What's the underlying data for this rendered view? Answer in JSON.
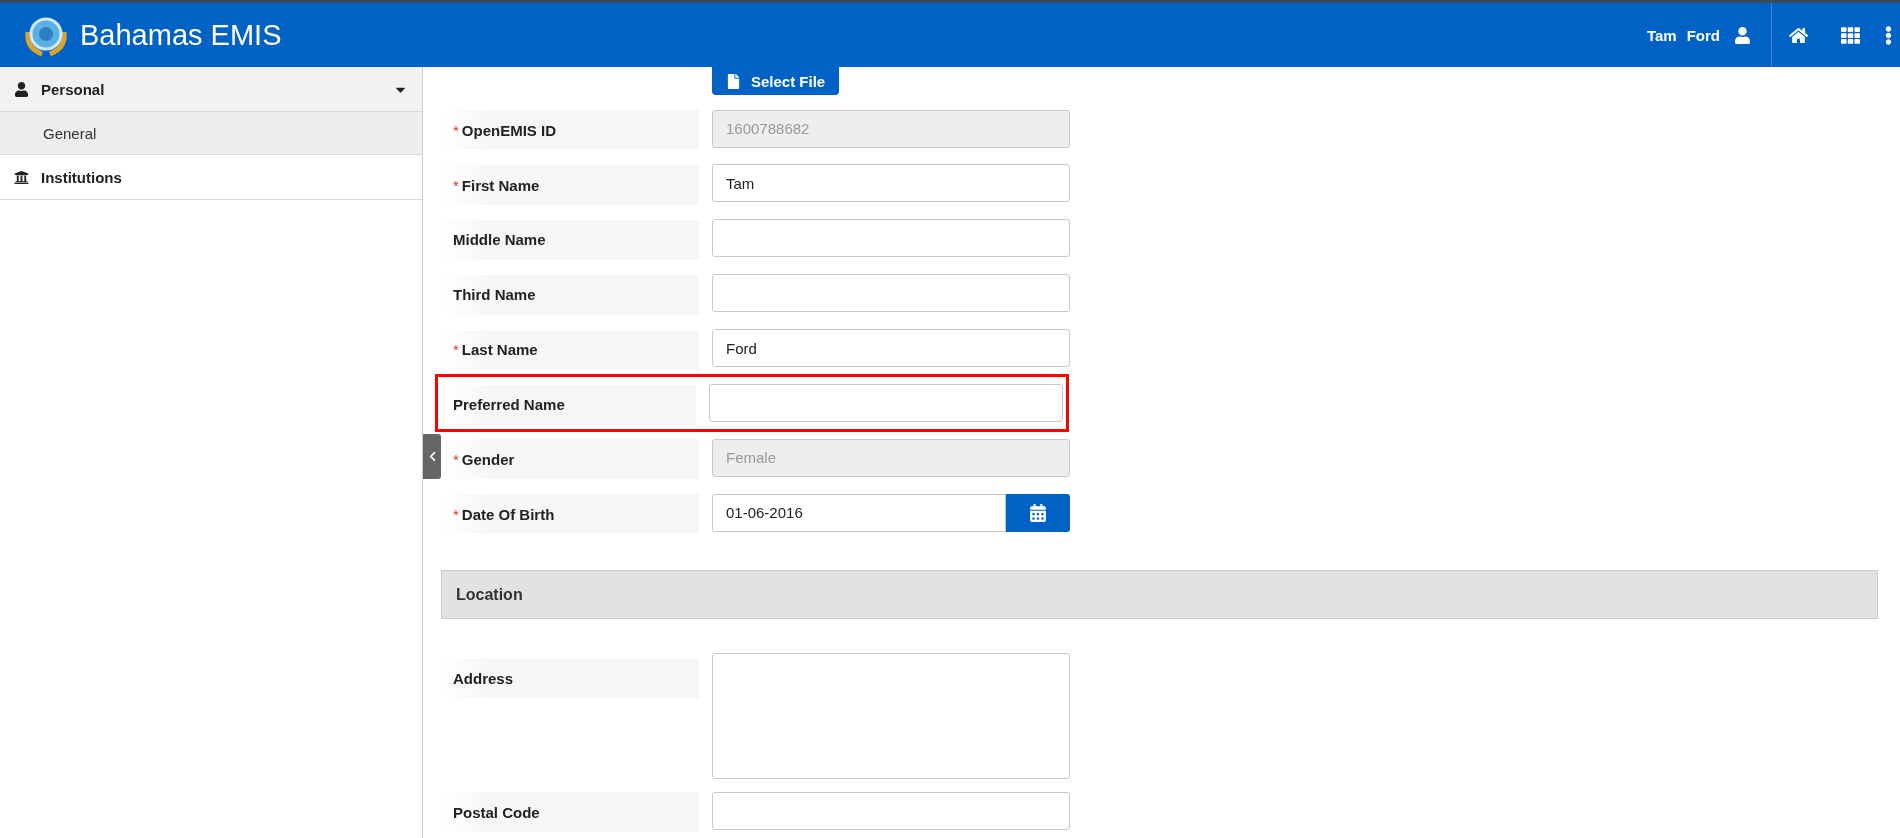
{
  "header": {
    "title": "Bahamas EMIS",
    "user": [
      "Tam",
      "Ford"
    ]
  },
  "sidebar": {
    "items": [
      {
        "label": "Personal",
        "expanded": true,
        "children": [
          {
            "label": "General",
            "selected": true
          }
        ]
      },
      {
        "label": "Institutions",
        "expanded": false
      }
    ]
  },
  "form": {
    "select_file": "Select File",
    "fields": [
      {
        "label": "OpenEMIS ID",
        "required_mark": "*",
        "disabled": true,
        "highlighted": false,
        "kind": "text",
        "value": "1600788682"
      },
      {
        "label": "First Name",
        "required_mark": "*",
        "disabled": false,
        "highlighted": false,
        "kind": "text",
        "value": "Tam"
      },
      {
        "label": "Middle Name",
        "disabled": false,
        "highlighted": false,
        "kind": "text"
      },
      {
        "label": "Third Name",
        "disabled": false,
        "highlighted": false,
        "kind": "text"
      },
      {
        "label": "Last Name",
        "required_mark": "*",
        "disabled": false,
        "highlighted": false,
        "kind": "text",
        "value": "Ford"
      },
      {
        "label": "Preferred Name",
        "disabled": false,
        "highlighted": true,
        "kind": "text"
      },
      {
        "label": "Gender",
        "required_mark": "*",
        "disabled": true,
        "highlighted": false,
        "kind": "text",
        "value": "Female"
      },
      {
        "label": "Date Of Birth",
        "required_mark": "*",
        "disabled": false,
        "highlighted": false,
        "kind": "date",
        "value": "01-06-2016"
      }
    ],
    "section": "Location",
    "location_fields": [
      {
        "label": "Address",
        "kind": "textarea"
      },
      {
        "label": "Postal Code",
        "kind": "text"
      }
    ]
  }
}
